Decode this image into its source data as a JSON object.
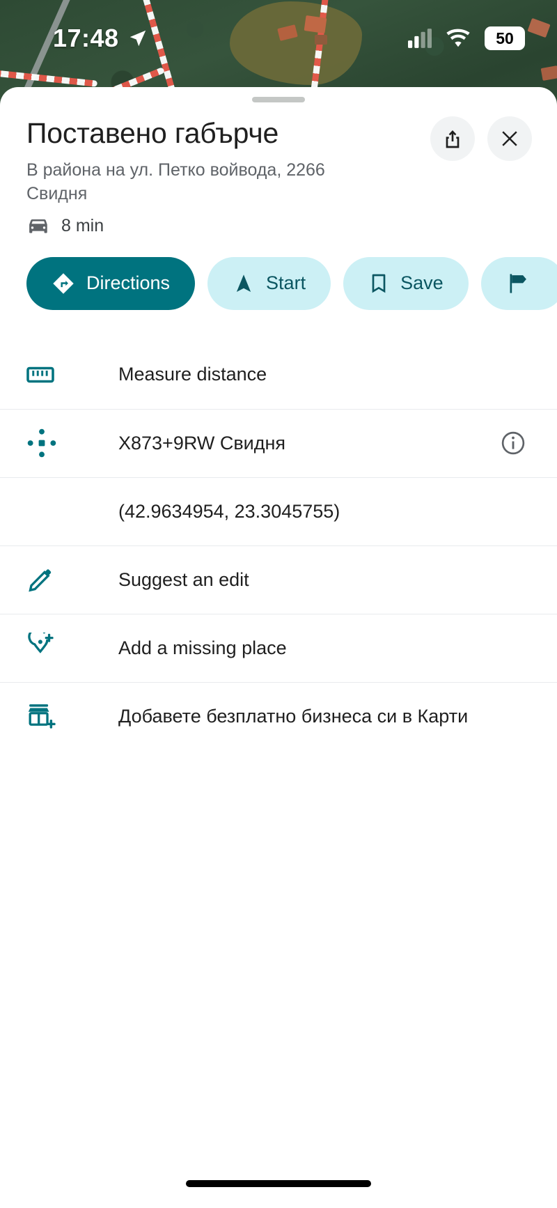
{
  "status_bar": {
    "time": "17:48",
    "location_icon": "navigation-arrow-icon",
    "signal_icon": "cellular-signal-icon",
    "wifi_icon": "wifi-icon",
    "battery_level": "50",
    "battery_icon": "battery-icon"
  },
  "sheet": {
    "drag_handle": "drag-handle",
    "title": "Поставено габърче",
    "address": "В района на ул. Петко войвода, 2266 Свидня",
    "share_icon": "share-icon",
    "close_icon": "close-icon",
    "travel": {
      "mode_icon": "car-icon",
      "duration": "8 min"
    },
    "actions": [
      {
        "label": "Directions",
        "icon": "directions-icon",
        "style": "primary"
      },
      {
        "label": "Start",
        "icon": "navigation-arrow-icon",
        "style": "secondary"
      },
      {
        "label": "Save",
        "icon": "bookmark-icon",
        "style": "secondary"
      },
      {
        "label": "",
        "icon": "flag-icon",
        "style": "secondary"
      }
    ],
    "list": [
      {
        "label": "Measure distance",
        "icon": "ruler-icon"
      },
      {
        "label": "X873+9RW Свидня",
        "icon": "plus-code-icon",
        "trailing_icon": "info-icon"
      },
      {
        "label": "(42.9634954, 23.3045755)",
        "icon": ""
      },
      {
        "label": "Suggest an edit",
        "icon": "pencil-icon"
      },
      {
        "label": "Add a missing place",
        "icon": "pin-plus-icon"
      },
      {
        "label": "Добавете безплатно бизнеса си в Карти",
        "icon": "store-plus-icon"
      }
    ]
  },
  "colors": {
    "accent_teal": "#00737F",
    "chip_light": "#CCF0F5",
    "icon_teal": "#00737F",
    "text_primary": "#1f1f1f",
    "text_secondary": "#5f6368",
    "divider": "#e8eaed"
  }
}
